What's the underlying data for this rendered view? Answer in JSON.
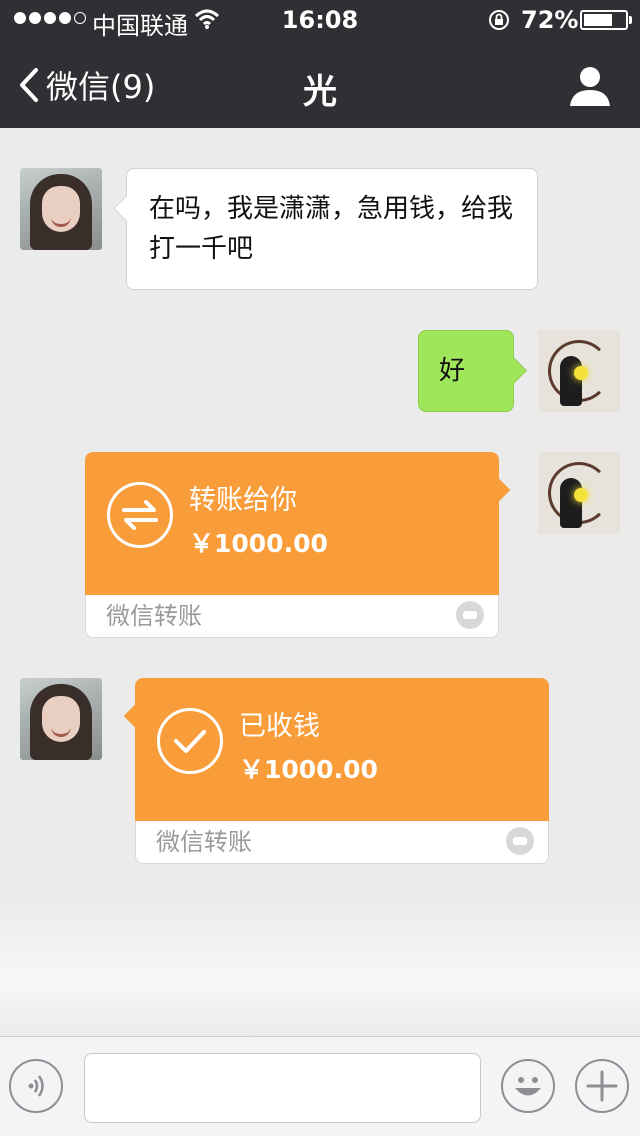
{
  "status_bar": {
    "carrier": "中国联通",
    "time": "16:08",
    "battery": "72%",
    "battery_level": 0.72,
    "signal_bars_filled": 4,
    "signal_bars_total": 5
  },
  "nav": {
    "back_label": "微信(9)",
    "title": "光",
    "bar_color": "#2e3033"
  },
  "messages": [
    {
      "sender": "contact",
      "type": "text",
      "text": "在吗，我是潇潇，急用钱，给我打一千吧"
    },
    {
      "sender": "me",
      "type": "text",
      "text": "好"
    },
    {
      "sender": "me",
      "type": "transfer",
      "title": "转账给你",
      "amount": "￥1000.00",
      "footer": "微信转账"
    },
    {
      "sender": "contact",
      "type": "transfer",
      "title": "已收钱",
      "amount": "￥1000.00",
      "footer": "微信转账"
    }
  ],
  "colors": {
    "transfer_orange": "#f99d3a",
    "outgoing_bubble": "#a0e65a",
    "incoming_bubble": "#ffffff"
  },
  "input_bar": {
    "text_value": ""
  },
  "icons": [
    "signal-dots-icon",
    "wifi-icon",
    "rotation-lock-icon",
    "battery-icon",
    "back-chevron-icon",
    "profile-icon",
    "transfer-arrows-icon",
    "check-circle-icon",
    "wechat-pay-logo-icon",
    "voice-icon",
    "emoji-icon",
    "plus-icon"
  ]
}
